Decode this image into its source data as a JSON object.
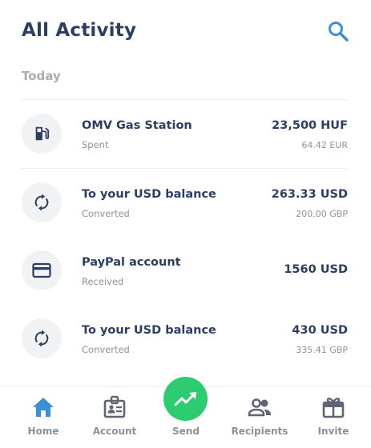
{
  "header": {
    "title": "All Activity",
    "search_icon": "search-icon"
  },
  "section": {
    "label": "Today"
  },
  "transactions": [
    {
      "icon": "gas-pump-icon",
      "name": "OMV Gas Station",
      "status": "Spent",
      "amount": "23,500 HUF",
      "amount_secondary": "64.42 EUR"
    },
    {
      "icon": "sync-icon",
      "name": "To your USD balance",
      "status": "Converted",
      "amount": "263.33 USD",
      "amount_secondary": "200.00 GBP"
    },
    {
      "icon": "credit-card-icon",
      "name": "PayPal account",
      "status": "Received",
      "amount": "1560 USD",
      "amount_secondary": ""
    },
    {
      "icon": "sync-icon",
      "name": "To your USD balance",
      "status": "Converted",
      "amount": "430 USD",
      "amount_secondary": "335.41 GBP"
    }
  ],
  "nav": {
    "items": [
      {
        "label": "Home",
        "icon": "home-icon",
        "active": true
      },
      {
        "label": "Account",
        "icon": "account-badge-icon",
        "active": false
      },
      {
        "label": "Send",
        "icon": "trending-up-icon",
        "active": false
      },
      {
        "label": "Recipients",
        "icon": "people-icon",
        "active": false
      },
      {
        "label": "Invite",
        "icon": "gift-icon",
        "active": false
      }
    ]
  },
  "colors": {
    "primary_text": "#2d3e63",
    "accent_blue": "#3b8fd9",
    "send_green": "#2ecc71",
    "muted": "#8d939c"
  }
}
